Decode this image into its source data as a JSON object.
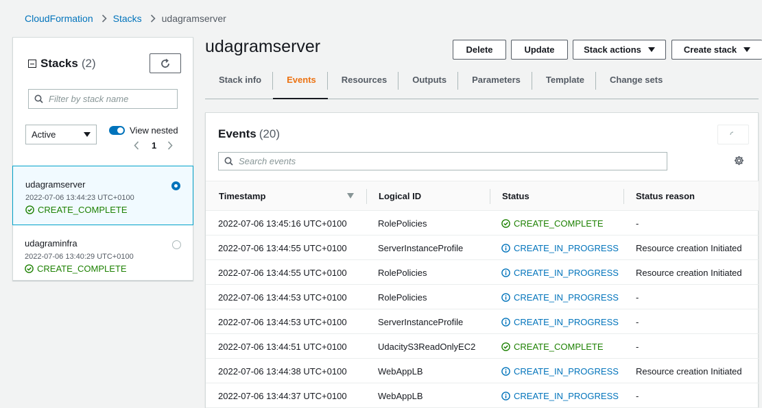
{
  "breadcrumb": {
    "items": [
      "CloudFormation",
      "Stacks"
    ],
    "current": "udagramserver"
  },
  "stacks_panel": {
    "title": "Stacks",
    "count": "(2)",
    "filter_placeholder": "Filter by stack name",
    "status_filter": "Active",
    "view_nested_label": "View nested",
    "page": "1",
    "stacks": [
      {
        "name": "udagramserver",
        "time": "2022-07-06 13:44:23 UTC+0100",
        "status": "CREATE_COMPLETE",
        "selected": true
      },
      {
        "name": "udagraminfra",
        "time": "2022-07-06 13:40:29 UTC+0100",
        "status": "CREATE_COMPLETE",
        "selected": false
      }
    ]
  },
  "header": {
    "title": "udagramserver",
    "buttons": {
      "delete": "Delete",
      "update": "Update",
      "stack_actions": "Stack actions",
      "create_stack": "Create stack"
    }
  },
  "tabs": [
    "Stack info",
    "Events",
    "Resources",
    "Outputs",
    "Parameters",
    "Template",
    "Change sets"
  ],
  "active_tab": "Events",
  "events": {
    "title": "Events",
    "count": "(20)",
    "search_placeholder": "Search events",
    "columns": [
      "Timestamp",
      "Logical ID",
      "Status",
      "Status reason"
    ],
    "rows": [
      {
        "timestamp": "2022-07-06 13:45:16 UTC+0100",
        "logical_id": "RolePolicies",
        "status": "CREATE_COMPLETE",
        "status_type": "success",
        "reason": "-"
      },
      {
        "timestamp": "2022-07-06 13:44:55 UTC+0100",
        "logical_id": "ServerInstanceProfile",
        "status": "CREATE_IN_PROGRESS",
        "status_type": "info",
        "reason": "Resource creation Initiated"
      },
      {
        "timestamp": "2022-07-06 13:44:55 UTC+0100",
        "logical_id": "RolePolicies",
        "status": "CREATE_IN_PROGRESS",
        "status_type": "info",
        "reason": "Resource creation Initiated"
      },
      {
        "timestamp": "2022-07-06 13:44:53 UTC+0100",
        "logical_id": "RolePolicies",
        "status": "CREATE_IN_PROGRESS",
        "status_type": "info",
        "reason": "-"
      },
      {
        "timestamp": "2022-07-06 13:44:53 UTC+0100",
        "logical_id": "ServerInstanceProfile",
        "status": "CREATE_IN_PROGRESS",
        "status_type": "info",
        "reason": "-"
      },
      {
        "timestamp": "2022-07-06 13:44:51 UTC+0100",
        "logical_id": "UdacityS3ReadOnlyEC2",
        "status": "CREATE_COMPLETE",
        "status_type": "success",
        "reason": "-"
      },
      {
        "timestamp": "2022-07-06 13:44:38 UTC+0100",
        "logical_id": "WebAppLB",
        "status": "CREATE_IN_PROGRESS",
        "status_type": "info",
        "reason": "Resource creation Initiated"
      },
      {
        "timestamp": "2022-07-06 13:44:37 UTC+0100",
        "logical_id": "WebAppLB",
        "status": "CREATE_IN_PROGRESS",
        "status_type": "info",
        "reason": "-"
      }
    ]
  },
  "colors": {
    "link": "#0073bb",
    "success": "#1d8102",
    "active_tab": "#ec7211",
    "selected_bg": "#f1faff"
  }
}
